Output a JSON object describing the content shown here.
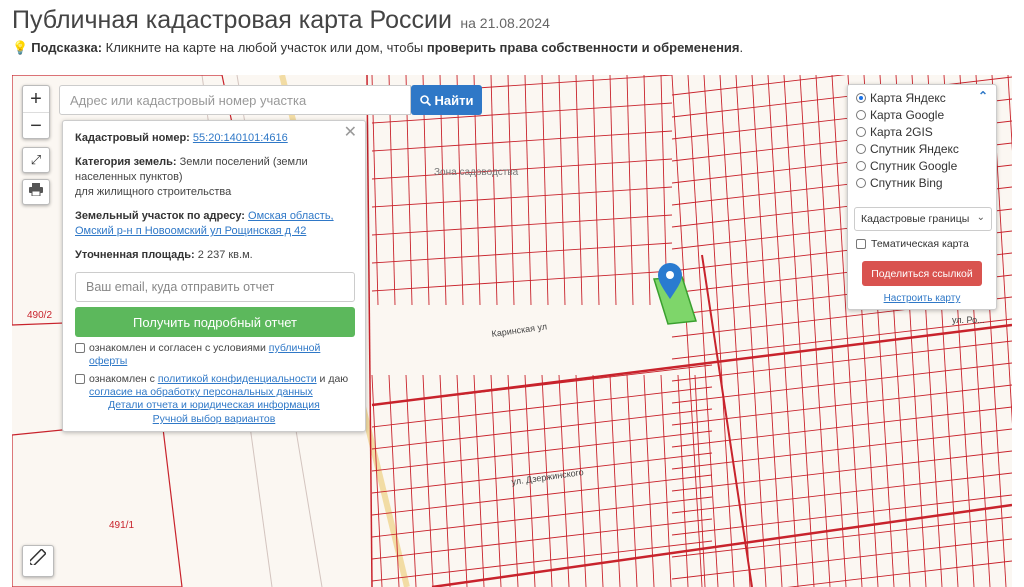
{
  "header": {
    "title": "Публичная кадастровая карта России",
    "date": "на 21.08.2024"
  },
  "hint": {
    "icon": "lightbulb-icon",
    "label": "Подсказка:",
    "text": "Кликните на карте на любой участок или дом, чтобы",
    "bold_text": "проверить права собственности и обременения",
    "end": "."
  },
  "map": {
    "zoom_in": "+",
    "zoom_out": "−",
    "search_placeholder": "Адрес или кадастровый номер участка",
    "search_button": "Найти",
    "labels": [
      "490/2",
      "491/1",
      "Зона садоводства",
      "ул. Ро...",
      "Каринская ул",
      "ул. Дзержинского"
    ]
  },
  "info_panel": {
    "cadastral_label": "Кадастровый номер:",
    "cadastral_number": "55:20:140101:4616",
    "category_label": "Категория земель:",
    "category_value": "Земли поселений (земли населенных пунктов)",
    "category_extra": "для жилищного строительства",
    "address_label": "Земельный участок по адресу:",
    "address_value": "Омская область, Омский р-н п Новоомский ул Рощинская д 42",
    "area_label": "Уточненная площадь:",
    "area_value": "2 237 кв.м.",
    "email_placeholder": "Ваш email, куда отправить отчет",
    "report_button": "Получить подробный отчет",
    "agree1_text": "ознакомлен и согласен с условиями",
    "agree1_link": "публичной оферты",
    "agree2_text": "ознакомлен с",
    "agree2_link": "политикой конфиденциальности",
    "agree2_and": "и даю",
    "agree2_link2": "согласие на обработку персональных данных",
    "link1": "Детали отчета и юридическая информация",
    "link2": "Ручной выбор вариантов"
  },
  "layers": {
    "options": [
      "Карта Яндекс",
      "Карта Google",
      "Карта 2GIS",
      "Спутник Яндекс",
      "Спутник Google",
      "Спутник Bing"
    ],
    "selected_index": 0,
    "select_value": "Кадастровые границы",
    "thematic": "Тематическая карта",
    "share_button": "Поделиться ссылкой",
    "configure_link": "Настроить карту"
  },
  "colors": {
    "accent": "#2f78c7",
    "green": "#5cb85c",
    "red": "#d9534f",
    "parcel": "#c8232c"
  }
}
